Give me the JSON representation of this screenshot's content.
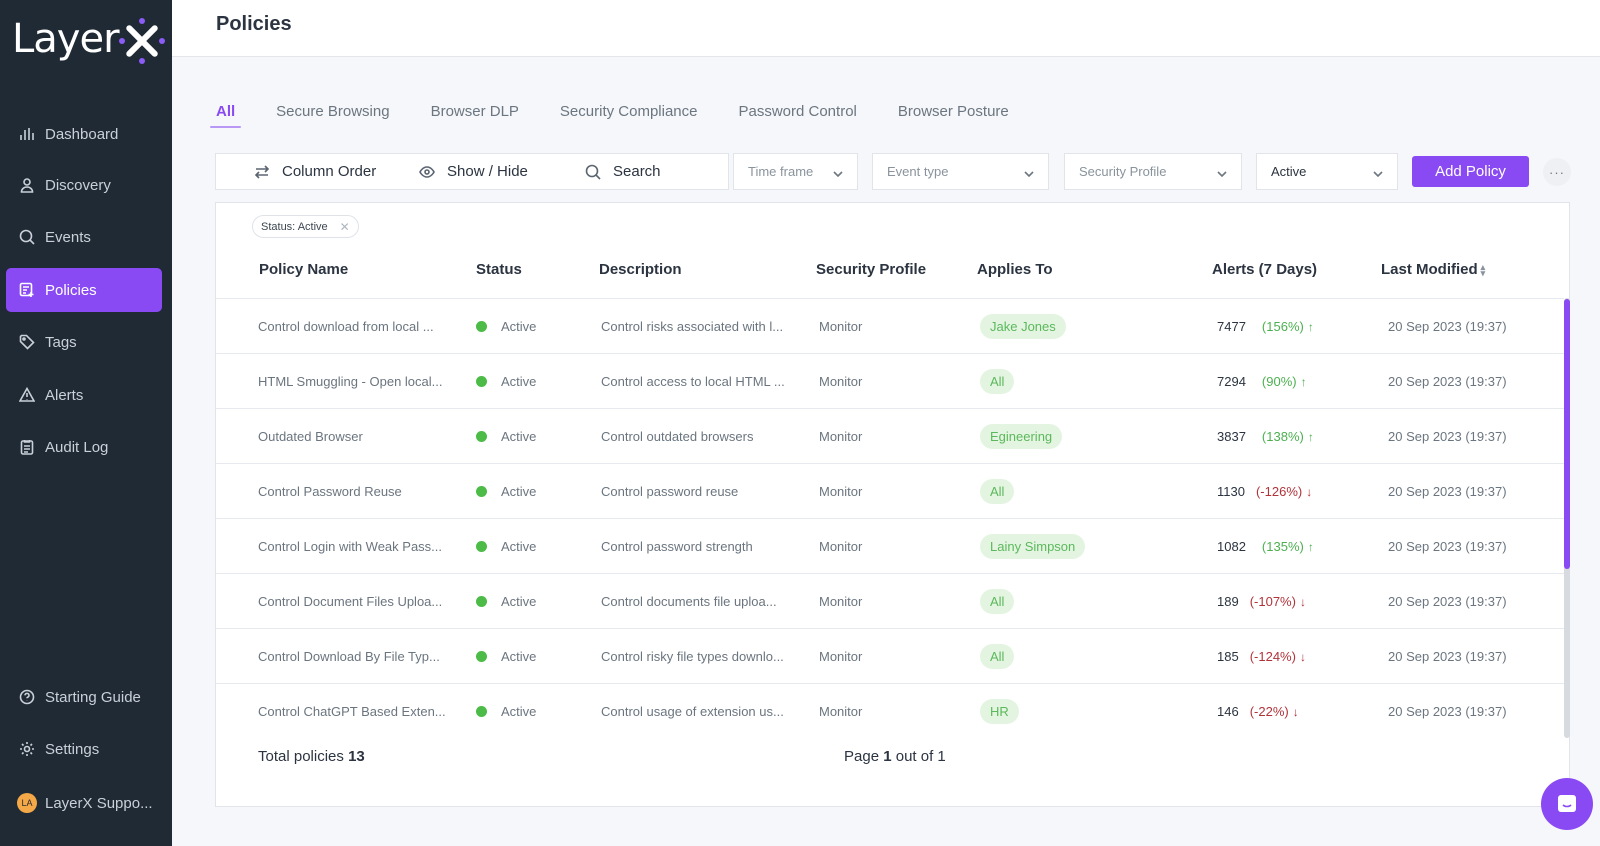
{
  "app": {
    "logo_text": "Layer",
    "brand_color": "#8a4af3"
  },
  "sidebar": {
    "items": [
      {
        "label": "Dashboard",
        "icon": "bar-chart-icon"
      },
      {
        "label": "Discovery",
        "icon": "user-icon"
      },
      {
        "label": "Events",
        "icon": "search-icon"
      },
      {
        "label": "Policies",
        "icon": "policy-list-icon",
        "active": true
      },
      {
        "label": "Tags",
        "icon": "tag-icon"
      },
      {
        "label": "Alerts",
        "icon": "warning-icon"
      },
      {
        "label": "Audit Log",
        "icon": "clipboard-icon"
      }
    ],
    "bottom_items": [
      {
        "label": "Starting Guide",
        "icon": "help-circle-icon"
      },
      {
        "label": "Settings",
        "icon": "gear-icon"
      }
    ],
    "user": {
      "initials": "LA",
      "name": "LayerX Suppo..."
    }
  },
  "header": {
    "title": "Policies"
  },
  "tabs": [
    {
      "label": "All",
      "active": true
    },
    {
      "label": "Secure Browsing"
    },
    {
      "label": "Browser DLP"
    },
    {
      "label": "Security Compliance"
    },
    {
      "label": "Password Control"
    },
    {
      "label": "Browser Posture"
    }
  ],
  "toolbar": {
    "column_order": "Column Order",
    "show_hide": "Show / Hide",
    "search_placeholder": "Search",
    "time_frame": "Time frame",
    "event_type": "Event type",
    "security_profile": "Security Profile",
    "status_value": "Active",
    "add_policy": "Add Policy",
    "more": "···"
  },
  "filters": {
    "chip_label": "Status: Active",
    "chip_close": "✕"
  },
  "table": {
    "columns": [
      "Policy Name",
      "Status",
      "Description",
      "Security Profile",
      "Applies To",
      "Alerts (7 Days)",
      "Last Modified"
    ],
    "rows": [
      {
        "name": "Control download from local ...",
        "status": "Active",
        "description": "Control risks associated with l...",
        "profile": "Monitor",
        "applies_to": "Jake Jones",
        "alerts": "7477",
        "change": "(156%)",
        "trend": "up",
        "modified": "20 Sep 2023 (19:37)"
      },
      {
        "name": "HTML Smuggling - Open local...",
        "status": "Active",
        "description": "Control access to local HTML ...",
        "profile": "Monitor",
        "applies_to": "All",
        "alerts": "7294",
        "change": "(90%)",
        "trend": "up",
        "modified": "20 Sep 2023 (19:37)"
      },
      {
        "name": "Outdated Browser",
        "status": "Active",
        "description": "Control outdated browsers",
        "profile": "Monitor",
        "applies_to": "Egineering",
        "alerts": "3837",
        "change": "(138%)",
        "trend": "up",
        "modified": "20 Sep 2023 (19:37)"
      },
      {
        "name": "Control Password Reuse",
        "status": "Active",
        "description": "Control password reuse",
        "profile": "Monitor",
        "applies_to": "All",
        "alerts": "1130",
        "change": "(-126%)",
        "trend": "down",
        "modified": "20 Sep 2023 (19:37)"
      },
      {
        "name": "Control Login with Weak Pass...",
        "status": "Active",
        "description": "Control password strength",
        "profile": "Monitor",
        "applies_to": "Lainy Simpson",
        "alerts": "1082",
        "change": "(135%)",
        "trend": "up",
        "modified": "20 Sep 2023 (19:37)"
      },
      {
        "name": "Control Document Files Uploa...",
        "status": "Active",
        "description": "Control documents file uploa...",
        "profile": "Monitor",
        "applies_to": "All",
        "alerts": "189",
        "change": "(-107%)",
        "trend": "down",
        "modified": "20 Sep 2023 (19:37)"
      },
      {
        "name": "Control Download By File Typ...",
        "status": "Active",
        "description": "Control risky file types downlo...",
        "profile": "Monitor",
        "applies_to": "All",
        "alerts": "185",
        "change": "(-124%)",
        "trend": "down",
        "modified": "20 Sep 2023 (19:37)"
      },
      {
        "name": "Control ChatGPT Based Exten...",
        "status": "Active",
        "description": "Control usage of extension us...",
        "profile": "Monitor",
        "applies_to": "HR",
        "alerts": "146",
        "change": "(-22%)",
        "trend": "down",
        "modified": "20 Sep 2023 (19:37)"
      }
    ]
  },
  "footer": {
    "total_label": "Total policies",
    "total_value": "13",
    "page_prefix": "Page",
    "page_current": "1",
    "page_suffix": "out of 1"
  },
  "colors": {
    "status_active": "#4cbb47",
    "trend_up": "#4cb050",
    "trend_down": "#b0333a"
  }
}
